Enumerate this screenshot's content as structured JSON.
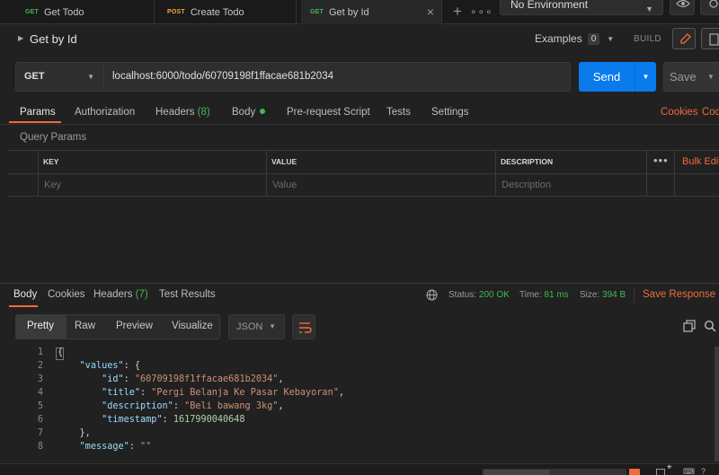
{
  "tabs": [
    {
      "method": "GET",
      "label": "Get Todo"
    },
    {
      "method": "POST",
      "label": "Create Todo"
    },
    {
      "method": "GET",
      "label": "Get by Id"
    }
  ],
  "environment": {
    "selected": "No Environment"
  },
  "request": {
    "name": "Get by Id",
    "examples_label": "Examples",
    "examples_count": "0",
    "build_label": "BUILD",
    "method": "GET",
    "url": "localhost:6000/todo/60709198f1ffacae681b2034",
    "send_label": "Send",
    "save_label": "Save"
  },
  "request_tabs": {
    "params": "Params",
    "authorization": "Authorization",
    "headers": "Headers",
    "headers_count": "(8)",
    "body": "Body",
    "pre_request": "Pre-request Script",
    "tests": "Tests",
    "settings": "Settings",
    "cookies": "Cookies",
    "code": "Code"
  },
  "query_params": {
    "title": "Query Params",
    "columns": [
      "KEY",
      "VALUE",
      "DESCRIPTION"
    ],
    "placeholders": [
      "Key",
      "Value",
      "Description"
    ],
    "bulk_edit": "Bulk Edit"
  },
  "response": {
    "tabs": {
      "body": "Body",
      "cookies": "Cookies",
      "headers": "Headers",
      "headers_count": "(7)",
      "test_results": "Test Results"
    },
    "status_label": "Status:",
    "status_value": "200 OK",
    "time_label": "Time:",
    "time_value": "81 ms",
    "size_label": "Size:",
    "size_value": "394 B",
    "save_response": "Save Response",
    "view_modes": [
      "Pretty",
      "Raw",
      "Preview",
      "Visualize"
    ],
    "format": "JSON",
    "line_numbers": [
      "1",
      "2",
      "3",
      "4",
      "5",
      "6",
      "7",
      "8"
    ],
    "json": {
      "open": "{",
      "values_key": "\"values\"",
      "values_open": "{",
      "id_key": "\"id\"",
      "id_val": "\"60709198f1ffacae681b2034\"",
      "title_key": "\"title\"",
      "title_val": "\"Pergi Belanja Ke Pasar Kebayoran\"",
      "desc_key": "\"description\"",
      "desc_val": "\"Beli bawang 3kg\"",
      "ts_key": "\"timestamp\"",
      "ts_val": "1617990040648",
      "values_close": "},",
      "message_key": "\"message\"",
      "message_val": "\"\""
    }
  },
  "colors": {
    "accent": "#f26b3a",
    "send": "#097bed",
    "success": "#3fb950",
    "background": "#212121"
  }
}
